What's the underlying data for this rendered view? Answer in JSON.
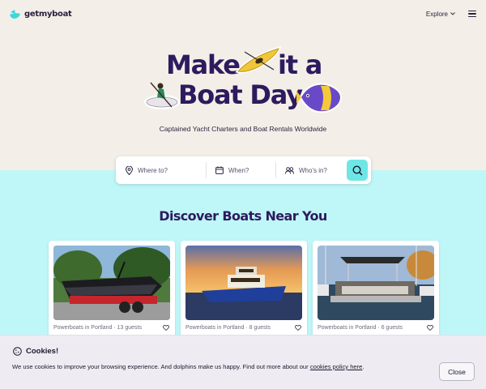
{
  "brand": {
    "name": "getmyboat"
  },
  "header": {
    "explore_label": "Explore"
  },
  "hero": {
    "headline_1": "Make",
    "headline_2": "it a",
    "headline_3": "Boat Day",
    "tagline": "Captained Yacht Charters and Boat Rentals Worldwide"
  },
  "search": {
    "where_placeholder": "Where to?",
    "when_placeholder": "When?",
    "who_placeholder": "Who's in?"
  },
  "section": {
    "title": "Discover Boats Near You"
  },
  "listings": [
    {
      "meta": "Powerboats in Portland · 13 guests"
    },
    {
      "meta": "Powerboats in Portland · 8 guests"
    },
    {
      "meta": "Powerboats in Portland · 6 guests"
    }
  ],
  "cookie": {
    "title": "Cookies!",
    "text": "We use cookies to improve your browsing experience. And dolphins make us happy. Find out more about our",
    "link": "cookies policy here",
    "suffix": ".",
    "close_label": "Close"
  },
  "colors": {
    "cream": "#f3efe8",
    "aqua": "#bff7f8",
    "accent": "#6ee6e6",
    "headline": "#2e1a5e"
  }
}
